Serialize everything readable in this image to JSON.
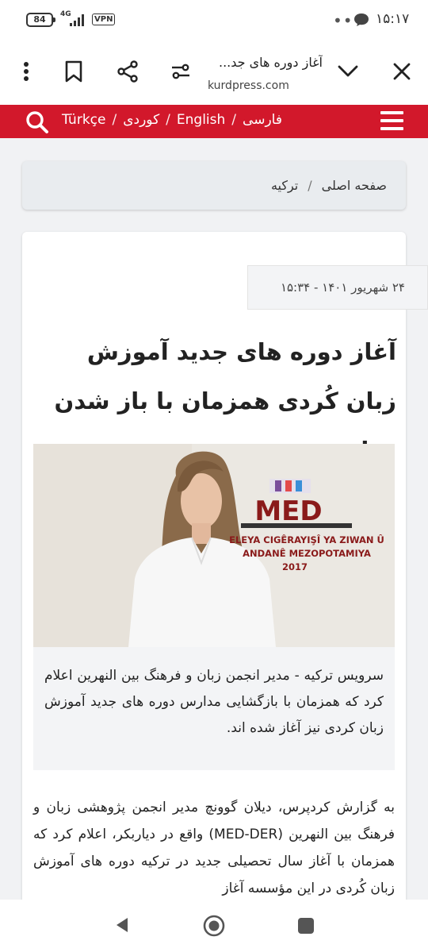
{
  "status": {
    "battery": "84",
    "network": "4G",
    "vpn": "VPN",
    "more": "•••",
    "time": "۱۵:۱۷"
  },
  "browser": {
    "title": "آغاز دوره های جد...",
    "url": "kurdpress.com"
  },
  "nav": {
    "lang_fa": "فارسی",
    "lang_en": "English",
    "lang_ku": "کوردی",
    "lang_tr": "Türkçe",
    "sep": "/"
  },
  "breadcrumb": {
    "home": "صفحه اصلی",
    "sep": "/",
    "current": "ترکیه"
  },
  "article": {
    "date": "۲۴ شهریور ۱۴۰۱ - ۱۵:۳۴",
    "headline": "آغاز دوره های جدید آموزش زبان کُردی همزمان با باز شدن مدارس",
    "photo_logo": "MED",
    "photo_line1": "ELEYA CIGÊRAYIŞÎ YA ZIWAN Û",
    "photo_line2": "ANDANÊ MEZOPOTAMIYA",
    "photo_year": "2017",
    "caption": "سرویس ترکیه - مدیر انجمن زبان و فرهنگ بین النهرین اعلام کرد که همزمان با بازگشایی مدارس دوره های جدید آموزش زبان کردی نیز آغاز شده اند.",
    "body": "به گزارش کردپرس، دیلان گوونچ مدیر انجمن پژوهشی زبان و فرهنگ بین النهرین (MED-DER) واقع در دیاربکر، اعلام کرد که همزمان با آغاز سال تحصیلی جدید در ترکیه دوره های آموزش زبان کُردی در این مؤسسه آغاز"
  }
}
